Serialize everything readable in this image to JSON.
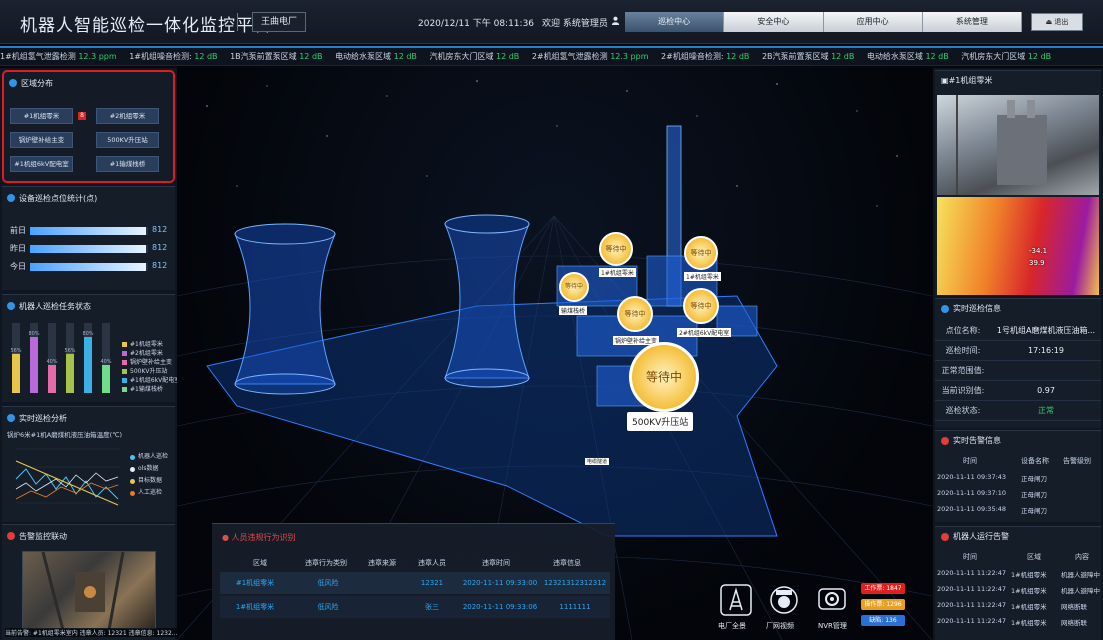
{
  "header": {
    "title": "机器人智能巡检一体化监控平台",
    "plant": "王曲电厂",
    "datetime": "2020/12/11  下午 08:11:36",
    "welcome": "欢迎 系统管理员",
    "nav": [
      "巡检中心",
      "安全中心",
      "应用中心",
      "系统管理"
    ],
    "active_nav": 0,
    "logout": "退出"
  },
  "ticker": [
    {
      "label": "1#机组氢气泄露检测",
      "value": "12.3 ppm"
    },
    {
      "label": "1#机组噪音检测:",
      "value": "12 dB"
    },
    {
      "label": "1B汽泵前置泵区域",
      "value": "12 dB"
    },
    {
      "label": "电动给水泵区域",
      "value": "12 dB"
    },
    {
      "label": "汽机房东大门区域",
      "value": "12 dB"
    },
    {
      "label": "2#机组氢气泄露检测",
      "value": "12.3 ppm"
    },
    {
      "label": "2#机组噪音检测:",
      "value": "12 dB"
    },
    {
      "label": "2B汽泵前置泵区域",
      "value": "12 dB"
    },
    {
      "label": "电动给水泵区域",
      "value": "12 dB"
    },
    {
      "label": "汽机房东大门区域",
      "value": "12 dB"
    }
  ],
  "area": {
    "title": "区域分布",
    "buttons": [
      "#1机组零米",
      "#2机组零米",
      "锅炉壁补给主变",
      "500KV升压站",
      "#1机组6kV配电室",
      "#1输煤栈桥"
    ],
    "badge": "8"
  },
  "stat": {
    "title": "设备巡检点位统计(点)",
    "rows": [
      {
        "label": "前日",
        "value": "812",
        "ratio": 0.98
      },
      {
        "label": "昨日",
        "value": "812",
        "ratio": 0.98
      },
      {
        "label": "今日",
        "value": "812",
        "ratio": 0.98
      }
    ]
  },
  "tasks": {
    "title": "机器人巡检任务状态",
    "bars": [
      {
        "label": "#1机组零米",
        "pct": "56%",
        "value": 56,
        "color": "#e8c64a"
      },
      {
        "label": "#2机组零米",
        "pct": "80%",
        "value": 80,
        "color": "#b86ad8"
      },
      {
        "label": "锅炉壁补给主变",
        "pct": "40%",
        "value": 40,
        "color": "#e56aa8"
      },
      {
        "label": "500KV升压站",
        "pct": "56%",
        "value": 56,
        "color": "#a6c24a"
      },
      {
        "label": "#1机组6kV配电室",
        "pct": "80%",
        "value": 80,
        "color": "#3ab0e6"
      },
      {
        "label": "#1输煤栈桥",
        "pct": "40%",
        "value": 40,
        "color": "#6fdc8a"
      }
    ]
  },
  "analysis": {
    "title": "实时巡检分析",
    "subtitle": "锅炉6米#1机A磨煤机液压油箱温度(℃)",
    "legend": [
      "机器人巡检",
      "ols数据",
      "目标数据",
      "人工巡检"
    ],
    "legend_colors": [
      "#4fc3f7",
      "#e6edf6",
      "#e8c64a",
      "#e67e22"
    ]
  },
  "alarmvid": {
    "title": "告警监控联动",
    "caption": "当前告警: #1机组零米室内  违章人员: 12321  违章信息: 1232..."
  },
  "right": {
    "cam_title": "#1机组零米",
    "thermal": [
      "-34.1",
      "39.9"
    ],
    "info_title": "实时巡检信息",
    "info_rows": [
      {
        "k": "点位名称:",
        "v": "1号机组A磨煤机液压油箱..."
      },
      {
        "k": "巡检时间:",
        "v": "17:16:19"
      },
      {
        "k": "正常范围值:",
        "v": ""
      },
      {
        "k": "当前识别值:",
        "v": "0.97"
      },
      {
        "k": "巡检状态:",
        "v": "正常"
      }
    ],
    "alarm_title": "实时告警信息",
    "alarm_headers": [
      "时间",
      "设备名称",
      "告警级别"
    ],
    "alarm_rows": [
      [
        "2020-11-11 09:37:43",
        "正母闸刀",
        ""
      ],
      [
        "2020-11-11 09:37:10",
        "正母闸刀",
        ""
      ],
      [
        "2020-11-11 09:35:48",
        "正母闸刀",
        ""
      ]
    ],
    "run_title": "机器人运行告警",
    "run_headers": [
      "时间",
      "区域",
      "内容"
    ],
    "run_rows": [
      [
        "2020-11-11 11:22:47",
        "1#机组零米",
        "机器人避障中"
      ],
      [
        "2020-11-11 11:22:47",
        "1#机组零米",
        "机器人避障中"
      ],
      [
        "2020-11-11 11:22:47",
        "1#机组零米",
        "网络断联"
      ],
      [
        "2020-11-11 11:22:47",
        "1#机组零米",
        "网络断联"
      ]
    ]
  },
  "violations": {
    "title": "人员违规行为识别",
    "headers": [
      "区域",
      "违章行为类别",
      "违章来源",
      "违章人员",
      "违章时间",
      "违章信息"
    ],
    "rows": [
      [
        "#1机组零米",
        "低风险",
        "",
        "12321",
        "2020-11-11 09:33:00",
        "12321312312312"
      ],
      [
        "1#机组零米",
        "低风险",
        "",
        "张三",
        "2020-11-11 09:33:06",
        "1111111"
      ]
    ]
  },
  "scene": {
    "markers": [
      "等待中",
      "等待中",
      "等待中",
      "等待中",
      "等待中",
      "等待中"
    ],
    "marker_labels": [
      "1#机组零米",
      "1#机组零米",
      "输煤栈桥",
      "锅炉壁补给主变",
      "2#机组6kV配电室",
      "500KV升压站"
    ],
    "small_label": "电缆隧道"
  },
  "quick": {
    "labels": [
      "电厂全景",
      "厂网视频",
      "NVR管理"
    ],
    "counts": [
      "工作票: 1847",
      "操作票: 1296",
      "缺陷: 136"
    ],
    "count_colors": [
      "#e02020",
      "#e8a020",
      "#2a6fd6"
    ]
  }
}
